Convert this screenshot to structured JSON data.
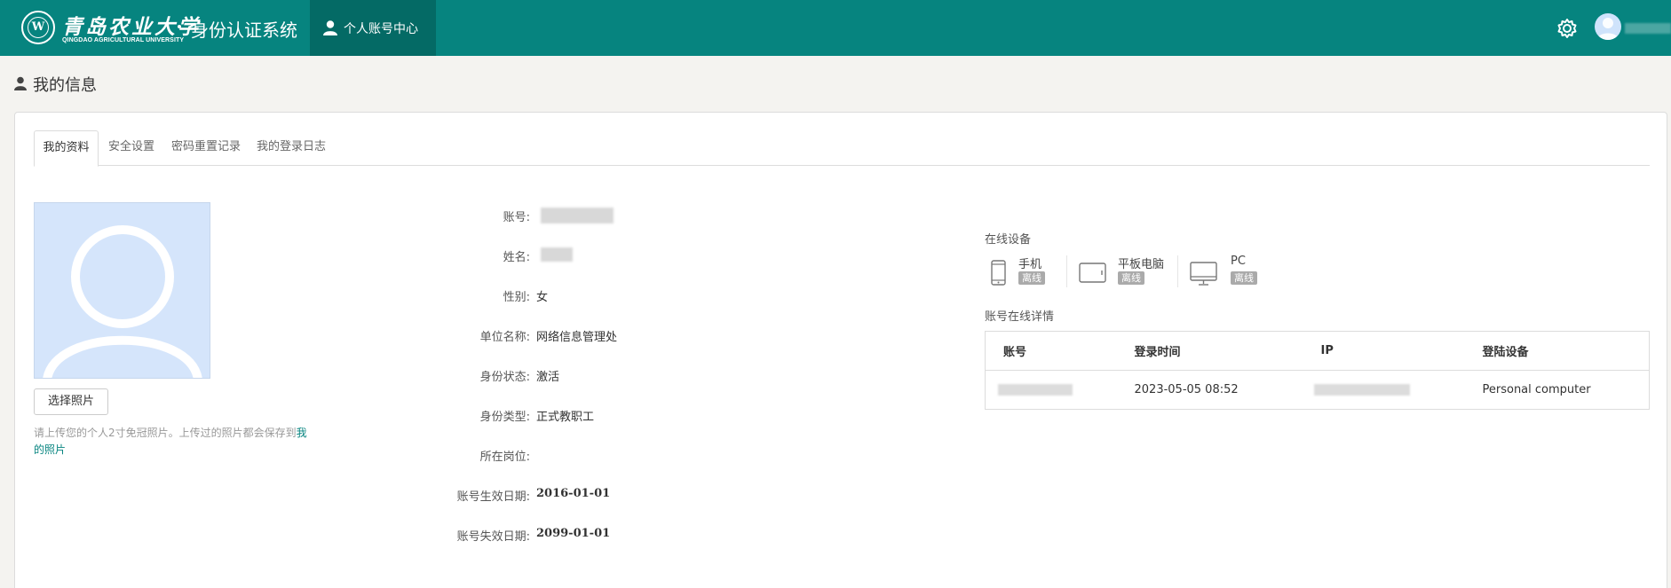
{
  "header": {
    "logo_seal_text": "W",
    "logo_cn": "青岛农业大学",
    "logo_en": "QINGDAO AGRICULTURAL UNIVERSITY",
    "system_title": "身份认证系统",
    "nav_tab_label": "个人账号中心",
    "settings_icon": "gear-icon",
    "brand_color": "#06847f"
  },
  "page": {
    "title": "我的信息"
  },
  "tabs": [
    {
      "label": "我的资料",
      "active": true
    },
    {
      "label": "安全设置",
      "active": false
    },
    {
      "label": "密码重置记录",
      "active": false
    },
    {
      "label": "我的登录日志",
      "active": false
    }
  ],
  "photo": {
    "choose_button": "选择照片",
    "hint_text": "请上传您的个人2寸免冠照片。上传过的照片都会保存到",
    "hint_link": "我的照片"
  },
  "profile": {
    "account_label": "账号:",
    "name_label": "姓名:",
    "gender_label": "性别:",
    "gender_value": "女",
    "unit_label": "单位名称:",
    "unit_value": "网络信息管理处",
    "status_label": "身份状态:",
    "status_value": "激活",
    "type_label": "身份类型:",
    "type_value": "正式教职工",
    "post_label": "所在岗位:",
    "post_value": "",
    "start_label": "账号生效日期:",
    "start_value": "2016-01-01",
    "end_label": "账号失效日期:",
    "end_value": "2099-01-01"
  },
  "online_devices": {
    "title": "在线设备",
    "devices": [
      {
        "name": "手机",
        "status": "离线",
        "icon": "phone-icon"
      },
      {
        "name": "平板电脑",
        "status": "离线",
        "icon": "tablet-icon"
      },
      {
        "name": "PC",
        "status": "离线",
        "icon": "monitor-icon"
      }
    ]
  },
  "online_detail": {
    "title": "账号在线详情",
    "columns": [
      "账号",
      "登录时间",
      "IP",
      "登陆设备"
    ],
    "rows": [
      {
        "account": "",
        "login_time": "2023-05-05 08:52",
        "ip": "",
        "device": "Personal computer"
      }
    ]
  }
}
